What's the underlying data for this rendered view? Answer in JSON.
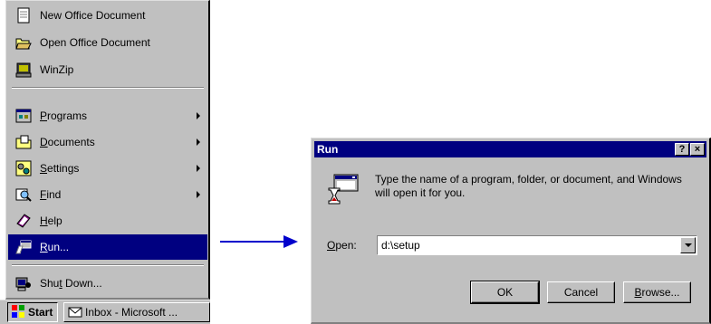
{
  "start_menu": {
    "top_items": [
      {
        "label": "New Office Document",
        "icon": "new-office-document-icon"
      },
      {
        "label": "Open Office Document",
        "icon": "open-folder-icon"
      },
      {
        "label": "WinZip",
        "icon": "winzip-icon"
      }
    ],
    "main_items": [
      {
        "pre": "",
        "u": "P",
        "post": "rograms",
        "icon": "programs-icon",
        "submenu": true
      },
      {
        "pre": "",
        "u": "D",
        "post": "ocuments",
        "icon": "documents-icon",
        "submenu": true
      },
      {
        "pre": "",
        "u": "S",
        "post": "ettings",
        "icon": "settings-icon",
        "submenu": true
      },
      {
        "pre": "",
        "u": "F",
        "post": "ind",
        "icon": "find-icon",
        "submenu": true
      },
      {
        "pre": "",
        "u": "H",
        "post": "elp",
        "icon": "help-icon",
        "submenu": false
      },
      {
        "pre": "",
        "u": "R",
        "post": "un...",
        "icon": "run-icon",
        "submenu": false
      }
    ],
    "shutdown": {
      "pre": "Shu",
      "u": "t",
      "post": " Down...",
      "icon": "shutdown-icon"
    }
  },
  "taskbar": {
    "start_label": "Start",
    "task_label": "Inbox - Microsoft ..."
  },
  "run_dialog": {
    "title": "Run",
    "help_btn": "?",
    "close_btn": "×",
    "description": "Type the name of a program, folder, or document, and Windows will open it for you.",
    "open_label_u": "O",
    "open_label_rest": "pen:",
    "open_value": "d:\\setup",
    "ok_label": "OK",
    "cancel_label": "Cancel",
    "browse_u": "B",
    "browse_rest": "rowse..."
  },
  "colors": {
    "highlight": "#000080",
    "face": "#c0c0c0",
    "arrow": "#0000cc"
  }
}
